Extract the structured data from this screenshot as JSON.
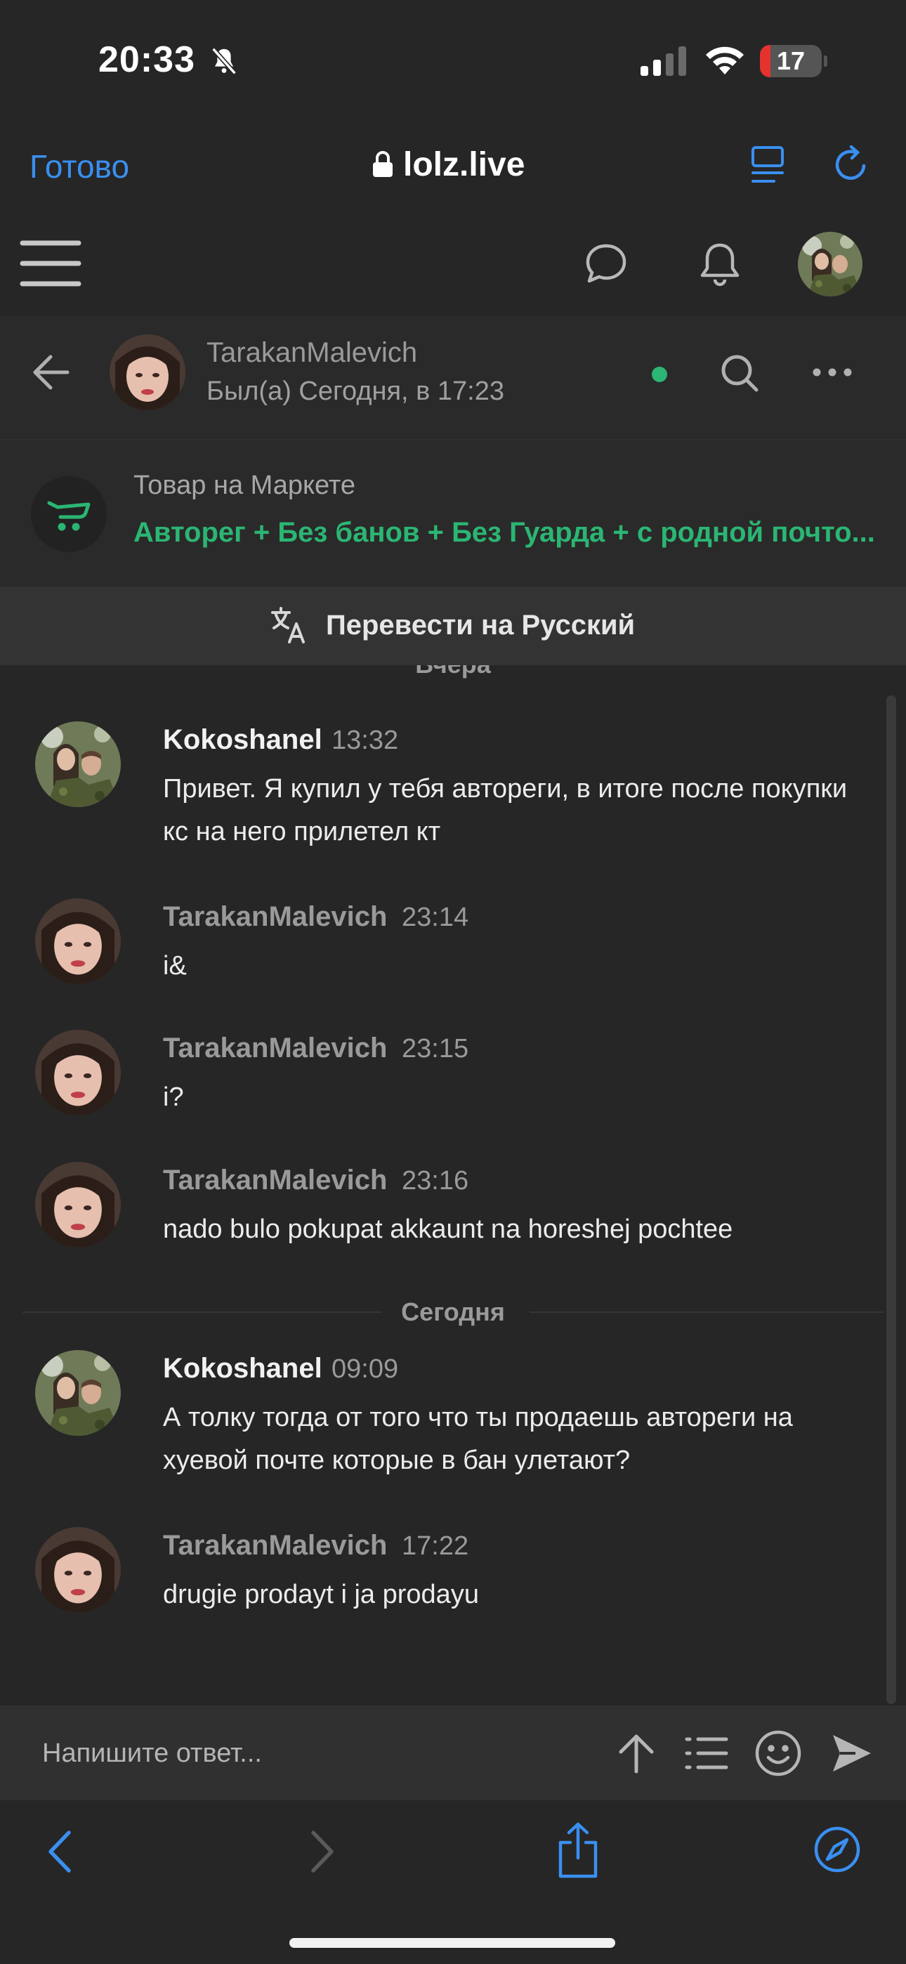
{
  "status_bar": {
    "time": "20:33",
    "battery_level": "17",
    "battery_fraction": 0.17
  },
  "browser": {
    "done_label": "Готово",
    "url": "lolz.live",
    "accent_color": "#3a8ff0"
  },
  "conversation": {
    "peer_name": "TarakanMalevich",
    "peer_status": "Был(а) Сегодня, в 17:23",
    "online_color": "#2bb673"
  },
  "market": {
    "label": "Товар на Маркете",
    "title": "Авторег + Без банов + Без Гуарда + с родной почто..."
  },
  "translate": {
    "label": "Перевести на Русский"
  },
  "dividers": [
    {
      "label": "Вчера"
    },
    {
      "label": "Сегодня"
    }
  ],
  "messages": [
    {
      "author": "Kokoshanel",
      "time": "13:32",
      "text": "Привет. Я купил у тебя автореги, в итоге после покупки кс на него прилетел кт"
    },
    {
      "author": "TarakanMalevich",
      "time": "23:14",
      "text": "i&"
    },
    {
      "author": "TarakanMalevich",
      "time": "23:15",
      "text": "i?"
    },
    {
      "author": "TarakanMalevich",
      "time": "23:16",
      "text": "nado bulo pokupat akkaunt na horeshej pochtee"
    },
    {
      "author": "Kokoshanel",
      "time": "09:09",
      "text": "А толку тогда от того что ты продаешь автореги на хуевой почте которые в бан улетают?"
    },
    {
      "author": "TarakanMalevich",
      "time": "17:22",
      "text": "drugie prodayt i ja prodayu"
    }
  ],
  "reply": {
    "placeholder": "Напишите ответ..."
  }
}
